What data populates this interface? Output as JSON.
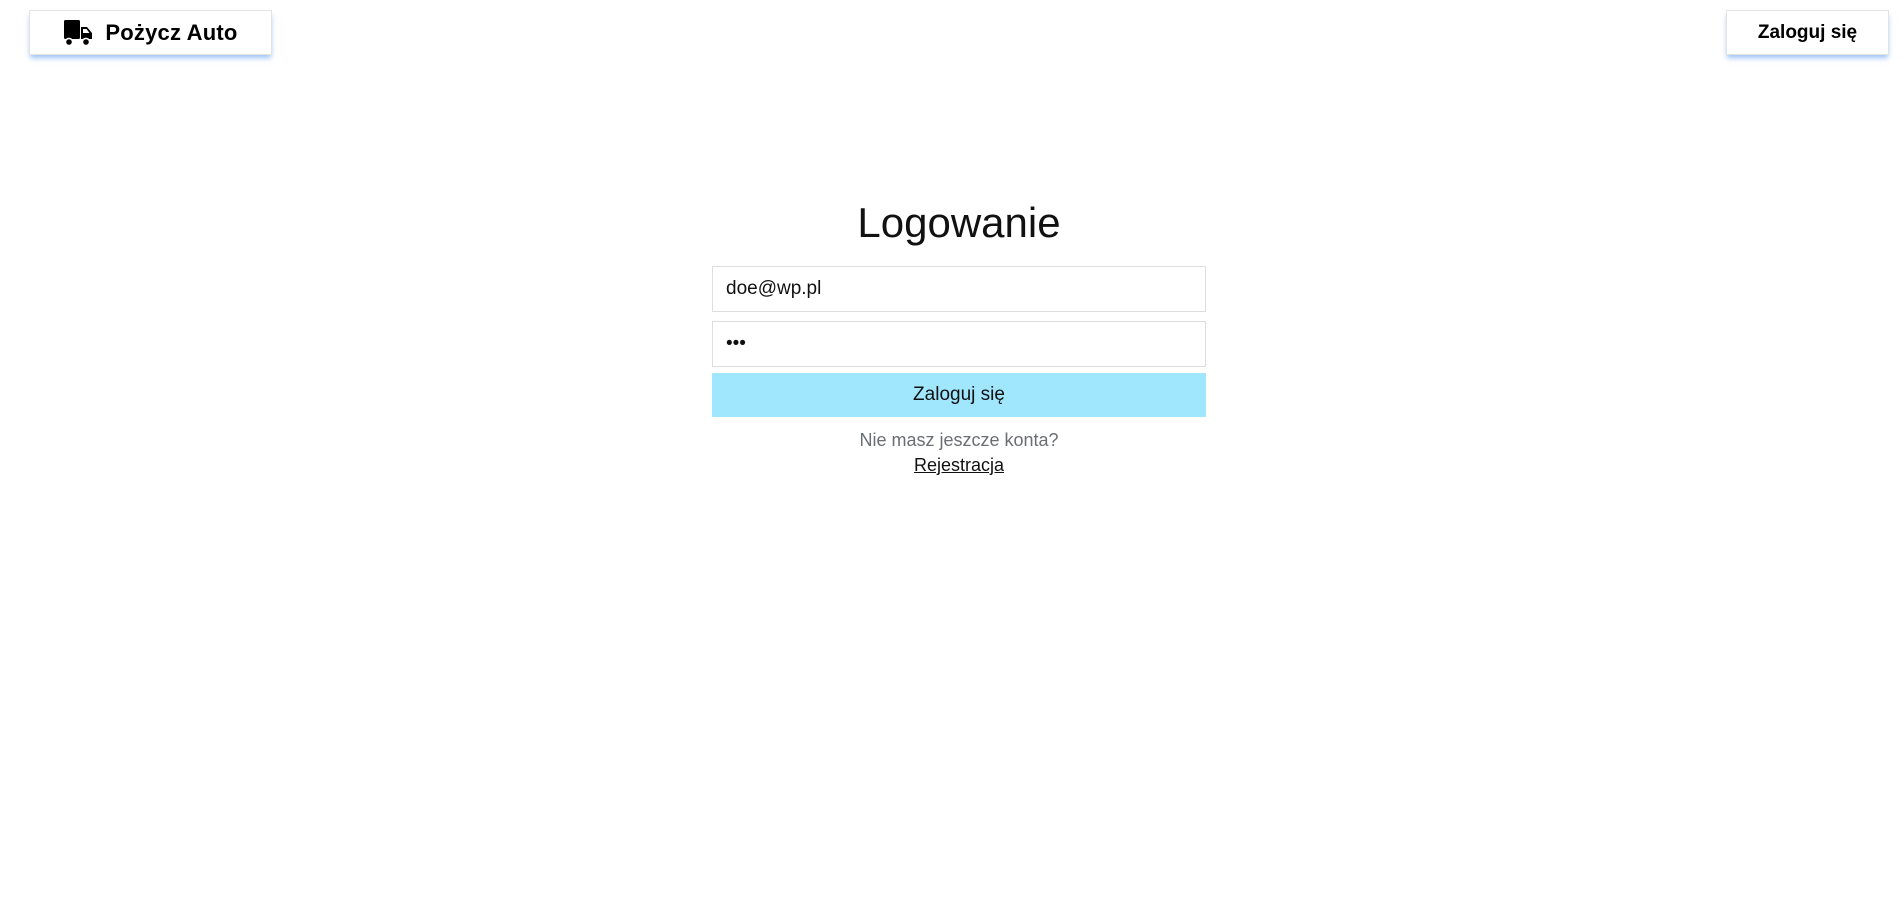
{
  "header": {
    "brand_label": "Pożycz Auto",
    "brand_icon": "truck-icon",
    "login_button_label": "Zaloguj się"
  },
  "login": {
    "title": "Logowanie",
    "email_value": "doe@wp.pl",
    "password_value": "abc",
    "submit_label": "Zaloguj się",
    "no_account_text": "Nie masz jeszcze konta?",
    "register_link_label": "Rejestracja"
  },
  "colors": {
    "submit_button_bg": "#a0e7fd",
    "button_shadow": "#4c90eb",
    "muted_text": "#6b6e73"
  }
}
